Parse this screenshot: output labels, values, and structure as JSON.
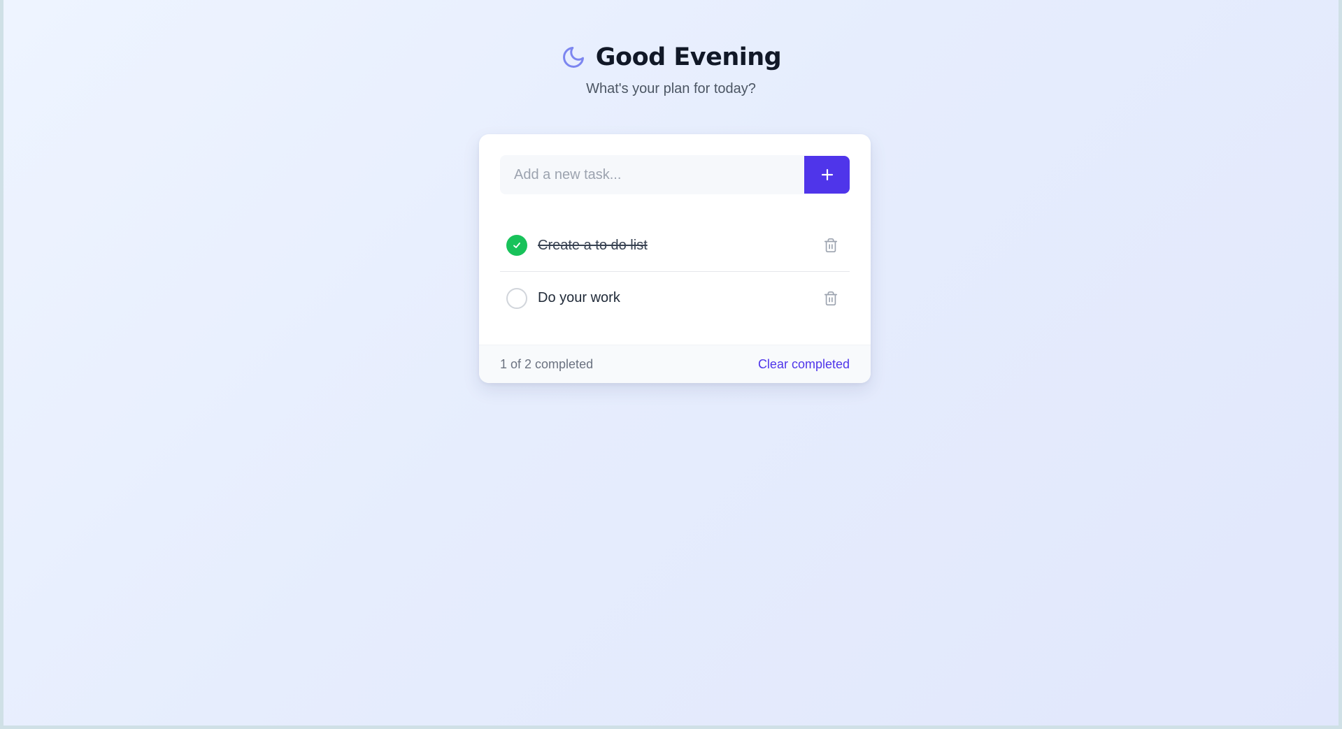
{
  "header": {
    "icon": "moon-icon",
    "title": "Good Evening",
    "subtitle": "What's your plan for today?"
  },
  "input": {
    "placeholder": "Add a new task...",
    "value": "",
    "add_icon": "plus-icon"
  },
  "tasks": [
    {
      "text": "Create a to do list",
      "completed": true
    },
    {
      "text": "Do your work",
      "completed": false
    }
  ],
  "footer": {
    "status": "1 of 2 completed",
    "clear_label": "Clear completed"
  },
  "colors": {
    "accent": "#4f35ea",
    "complete": "#18c25a",
    "moon": "#7c86f0",
    "title": "#111827"
  }
}
